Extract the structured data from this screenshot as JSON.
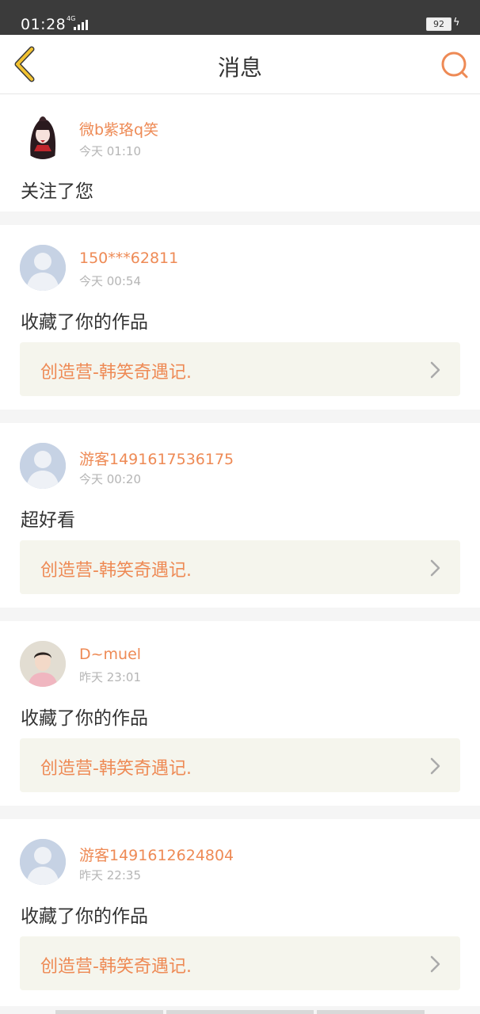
{
  "status_bar": {
    "time": "01:28",
    "network": "4G",
    "battery": "92"
  },
  "header": {
    "title": "消息"
  },
  "messages": [
    {
      "user": "微b紫珞q笑",
      "time": "今天 01:10",
      "action": "关注了您",
      "work": null,
      "avatar": "anime-girl-avatar"
    },
    {
      "user": "150***62811",
      "time": "今天 00:54",
      "action": "收藏了你的作品",
      "work": "创造营-韩笑奇遇记.",
      "avatar": "default-avatar"
    },
    {
      "user": "游客1491617536175",
      "time": "今天 00:20",
      "action": "超好看",
      "work": "创造营-韩笑奇遇记.",
      "avatar": "default-avatar"
    },
    {
      "user": "D~muel",
      "time": "昨天 23:01",
      "action": "收藏了你的作品",
      "work": "创造营-韩笑奇遇记.",
      "avatar": "photo-avatar"
    },
    {
      "user": "游客1491612624804",
      "time": "昨天 22:35",
      "action": "收藏了你的作品",
      "work": "创造营-韩笑奇遇记.",
      "avatar": "default-avatar"
    }
  ],
  "colors": {
    "accent": "#ee8a55",
    "back_arrow": "#f2c230",
    "status_bar": "#3b3b3b",
    "work_bg": "#f5f5ed"
  }
}
